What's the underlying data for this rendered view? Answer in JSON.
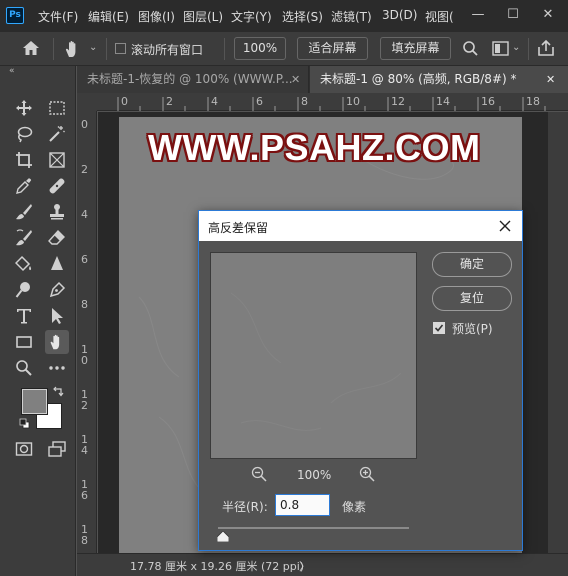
{
  "app": {
    "logo": "Ps"
  },
  "menu": [
    "文件(F)",
    "编辑(E)",
    "图像(I)",
    "图层(L)",
    "文字(Y)",
    "选择(S)",
    "滤镜(T)",
    "3D(D)",
    "视图("
  ],
  "window_controls": {
    "minimize": "—",
    "maximize": "☐",
    "close": "✕"
  },
  "options_bar": {
    "scroll_all_label": "滚动所有窗口",
    "zoom_value": "100%",
    "fit_screen_label": "适合屏幕",
    "fill_screen_label": "填充屏幕"
  },
  "tabs": [
    {
      "label": "未标题-1-恢复的 @ 100% (WWW.P...",
      "close": "✕"
    },
    {
      "label": "未标题-1 @ 80% (高频, RGB/8#) *",
      "close": "✕"
    }
  ],
  "rulers": {
    "top": [
      "0",
      "2",
      "4",
      "6",
      "8",
      "10",
      "12",
      "14",
      "16",
      "18"
    ],
    "left": [
      "0",
      "2",
      "4",
      "6",
      "8",
      "1\n0",
      "1\n2",
      "1\n4",
      "1\n6",
      "1\n8"
    ]
  },
  "canvas": {
    "watermark_text": "WWW.PSAHZ.COM",
    "doc_color": "#808080",
    "watermark_stroke": "#7a1010"
  },
  "status": {
    "text": "17.78 厘米 x 19.26 厘米 (72 ppi)",
    "arrow": "〉"
  },
  "dialog": {
    "title": "高反差保留",
    "ok_label": "确定",
    "reset_label": "复位",
    "preview_label": "预览(P)",
    "preview_checked": true,
    "zoom_percent": "100%",
    "radius_label": "半径(R):",
    "radius_value": "0.8",
    "radius_unit": "像素",
    "accent": "#2c7ad6"
  },
  "colors": {
    "foreground": "#808080",
    "background": "#ffffff"
  }
}
